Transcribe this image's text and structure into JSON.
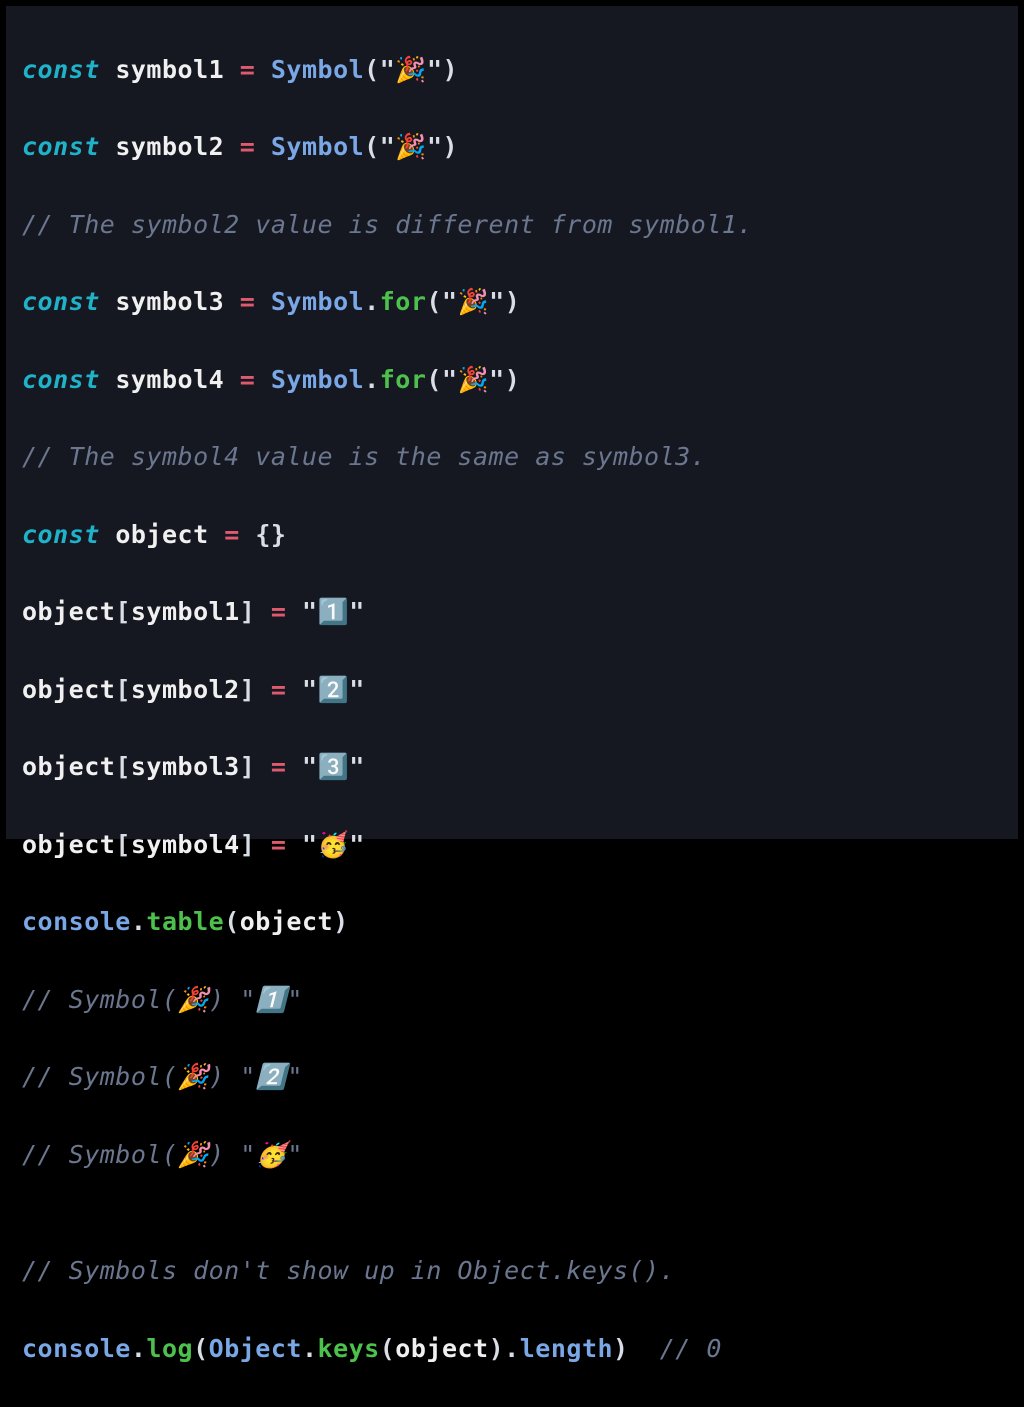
{
  "code": {
    "sym1_decl": {
      "kw": "const ",
      "name": "symbol1",
      "sp": " ",
      "eq": "=",
      "sp2": " ",
      "cls": "Symbol",
      "lp": "(",
      "q1": "\"",
      "emoji": "🎉",
      "q2": "\"",
      "rp": ")"
    },
    "sym2_decl": {
      "kw": "const ",
      "name": "symbol2",
      "sp": " ",
      "eq": "=",
      "sp2": " ",
      "cls": "Symbol",
      "lp": "(",
      "q1": "\"",
      "emoji": "🎉",
      "q2": "\"",
      "rp": ")"
    },
    "cmt1": "// The symbol2 value is different from symbol1.",
    "sym3_decl": {
      "kw": "const ",
      "name": "symbol3",
      "sp": " ",
      "eq": "=",
      "sp2": " ",
      "cls": "Symbol",
      "dot": ".",
      "mth": "for",
      "lp": "(",
      "q1": "\"",
      "emoji": "🎉",
      "q2": "\"",
      "rp": ")"
    },
    "sym4_decl": {
      "kw": "const ",
      "name": "symbol4",
      "sp": " ",
      "eq": "=",
      "sp2": " ",
      "cls": "Symbol",
      "dot": ".",
      "mth": "for",
      "lp": "(",
      "q1": "\"",
      "emoji": "🎉",
      "q2": "\"",
      "rp": ")"
    },
    "cmt2": "// The symbol4 value is the same as symbol3.",
    "obj_decl": {
      "kw": "const ",
      "name": "object",
      "sp": " ",
      "eq": "=",
      "sp2": " ",
      "br": "{}"
    },
    "assign1": {
      "obj": "object",
      "lb": "[",
      "key": "symbol1",
      "rb": "]",
      "sp": " ",
      "eq": "=",
      "sp2": " ",
      "q1": "\"",
      "val": "1️⃣",
      "q2": "\""
    },
    "assign2": {
      "obj": "object",
      "lb": "[",
      "key": "symbol2",
      "rb": "]",
      "sp": " ",
      "eq": "=",
      "sp2": " ",
      "q1": "\"",
      "val": "2️⃣",
      "q2": "\""
    },
    "assign3": {
      "obj": "object",
      "lb": "[",
      "key": "symbol3",
      "rb": "]",
      "sp": " ",
      "eq": "=",
      "sp2": " ",
      "q1": "\"",
      "val": "3️⃣",
      "q2": "\""
    },
    "assign4": {
      "obj": "object",
      "lb": "[",
      "key": "symbol4",
      "rb": "]",
      "sp": " ",
      "eq": "=",
      "sp2": " ",
      "q1": "\"",
      "val": "🥳",
      "q2": "\""
    },
    "ctable": {
      "obj": "console",
      "dot": ".",
      "mth": "table",
      "lp": "(",
      "arg": "object",
      "rp": ")"
    },
    "cmt_out1": "// Symbol(🎉) \"1️⃣\"",
    "cmt_out2": "// Symbol(🎉) \"2️⃣\"",
    "cmt_out3": "// Symbol(🎉) \"🥳\"",
    "blank": "",
    "cmt3": "// Symbols don't show up in Object.keys().",
    "clog": {
      "obj": "console",
      "dot": ".",
      "mth": "log",
      "lp": "(",
      "o2": "Object",
      "d2": ".",
      "m2": "keys",
      "lp2": "(",
      "arg": "object",
      "rp2": ")",
      "d3": ".",
      "m3": "length",
      "rp": ")",
      "sp": "  ",
      "trail": "// 0"
    }
  }
}
